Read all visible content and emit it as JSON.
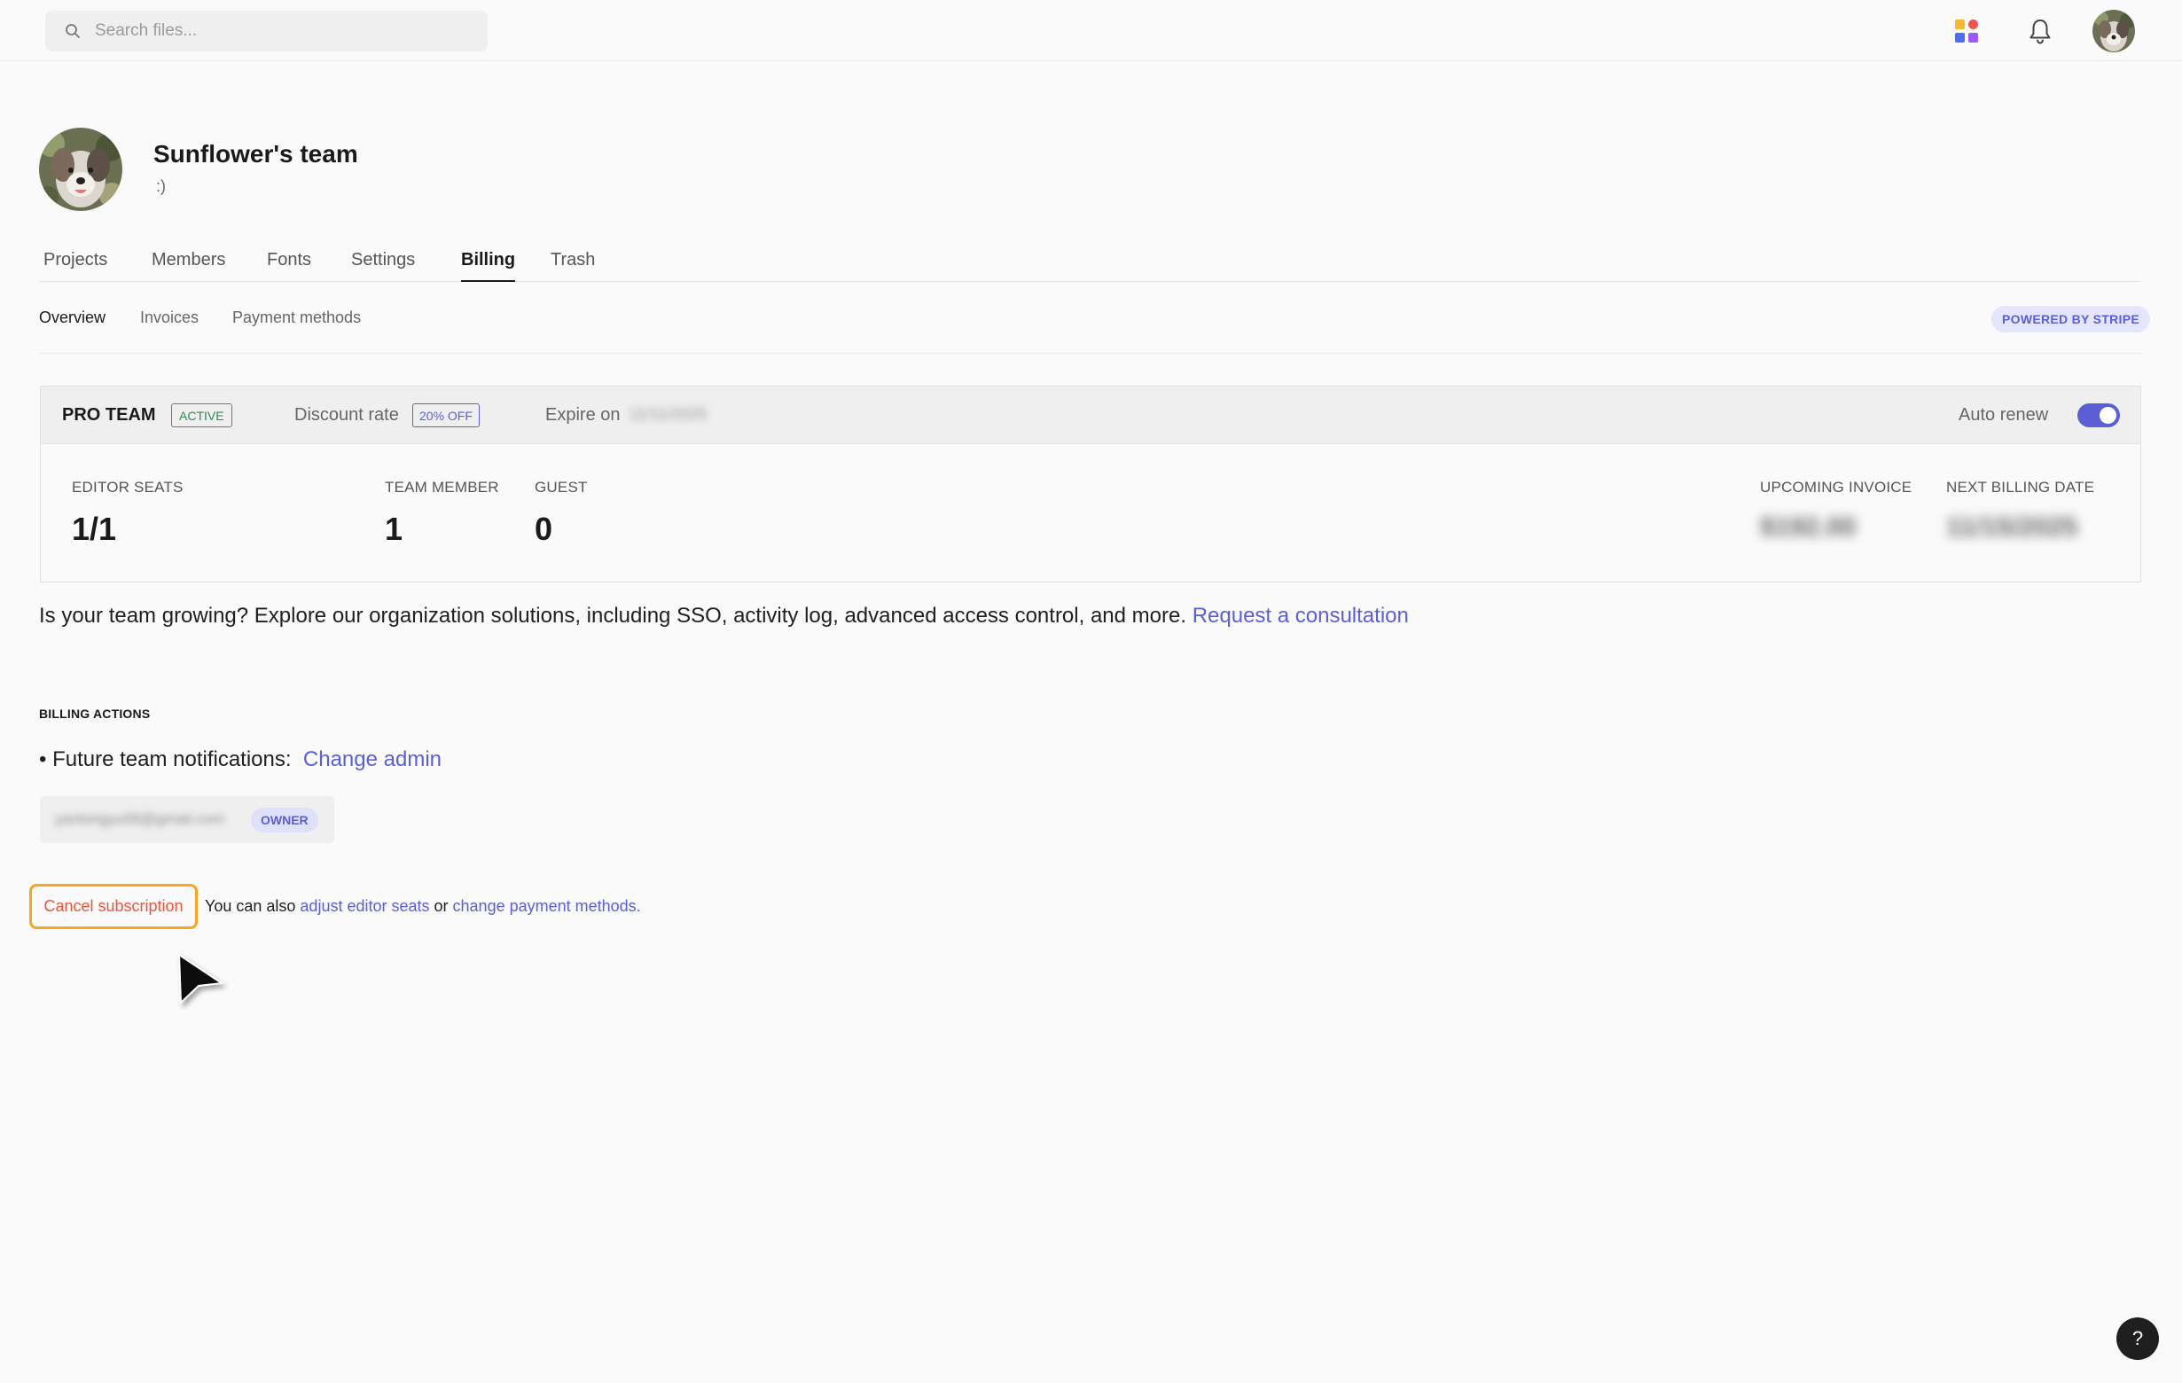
{
  "search": {
    "placeholder": "Search files..."
  },
  "header_icons": {
    "apps": "apps-grid-icon",
    "notifications": "bell-icon",
    "avatar": "user-avatar"
  },
  "team": {
    "name": "Sunflower's team",
    "description": ":)"
  },
  "tabs": [
    {
      "label": "Projects"
    },
    {
      "label": "Members"
    },
    {
      "label": "Fonts"
    },
    {
      "label": "Settings"
    },
    {
      "label": "Billing",
      "active": true
    },
    {
      "label": "Trash"
    }
  ],
  "subtabs": [
    {
      "label": "Overview",
      "active": true
    },
    {
      "label": "Invoices"
    },
    {
      "label": "Payment methods"
    }
  ],
  "stripe_badge": "POWERED BY STRIPE",
  "plan": {
    "name": "PRO TEAM",
    "status": "ACTIVE",
    "discount_label": "Discount rate",
    "discount_value": "20% OFF",
    "expire_label": "Expire on",
    "expire_value": "11/11/2025",
    "auto_renew_label": "Auto renew",
    "auto_renew": true,
    "stats": {
      "editor_seats": {
        "label": "EDITOR SEATS",
        "value": "1/1"
      },
      "team_member": {
        "label": "TEAM MEMBER",
        "value": "1"
      },
      "guest": {
        "label": "GUEST",
        "value": "0"
      },
      "upcoming_invoice": {
        "label": "UPCOMING INVOICE",
        "value": "$192.00"
      },
      "next_billing_date": {
        "label": "NEXT BILLING DATE",
        "value": "11/15/2025"
      }
    }
  },
  "growing": {
    "text": "Is your team growing? Explore our organization solutions, including SSO, activity log, advanced access control, and more. ",
    "link": "Request a consultation"
  },
  "billing_actions": {
    "title": "BILLING ACTIONS",
    "future_label": "Future team notifications:",
    "change_admin": "Change admin",
    "admin_email": "yanlongyu08@gmail.com",
    "owner_badge": "OWNER",
    "cancel": "Cancel subscription",
    "also_prefix": "You can also ",
    "adjust_seats": "adjust editor seats",
    "or": " or ",
    "change_payment": "change payment methods."
  },
  "help": "?",
  "colors": {
    "accent": "#5b5fd6",
    "active_green": "#2f8a4c",
    "cancel_red": "#e8553a",
    "focus_ring": "#f5a623"
  }
}
